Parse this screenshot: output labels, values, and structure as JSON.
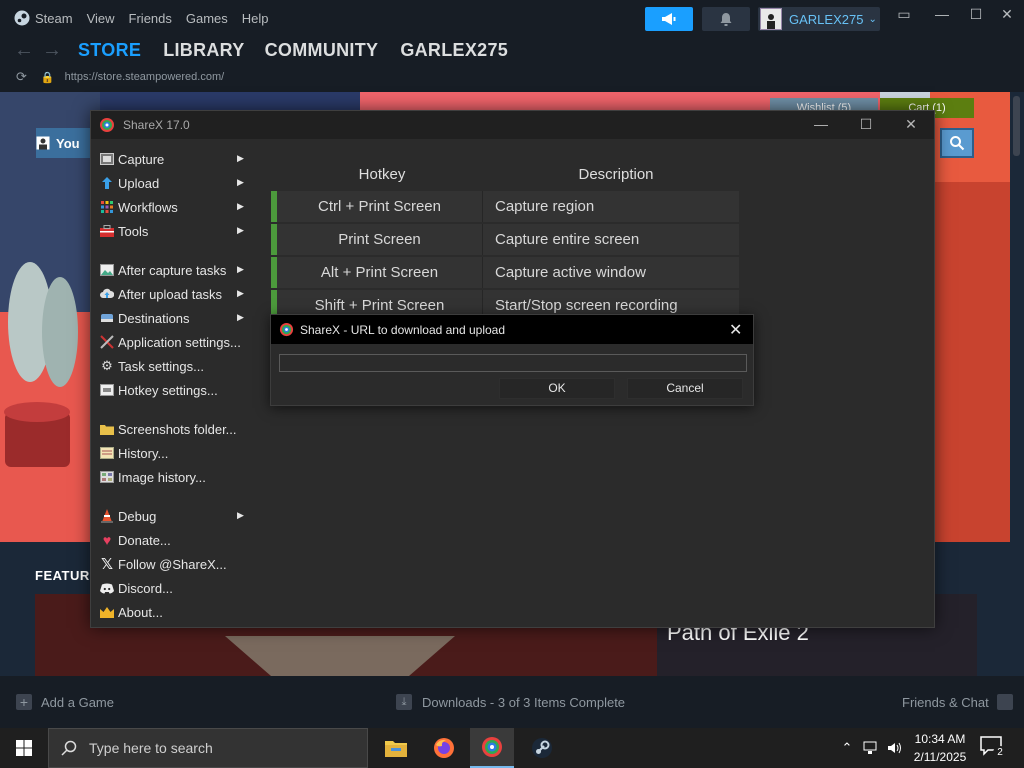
{
  "steam": {
    "menu": [
      "Steam",
      "View",
      "Friends",
      "Games",
      "Help"
    ],
    "username": "GARLEX275",
    "tabs": [
      "STORE",
      "LIBRARY",
      "COMMUNITY",
      "GARLEX275"
    ],
    "url": "https://store.steampowered.com/",
    "store": {
      "search_label": "You",
      "wishlist": "Wishlist (5)",
      "cart": "Cart (1)",
      "featured_label": "FEATUR",
      "featured_game": "Path of Exile 2"
    },
    "bottom": {
      "add_game": "Add a Game",
      "downloads": "Downloads - 3 of 3 Items Complete",
      "friends_chat": "Friends & Chat"
    },
    "colors": {
      "accent": "#1a9fff",
      "link": "#67c1f5",
      "bg": "#171d25"
    }
  },
  "sharex": {
    "title": "ShareX 17.0",
    "menu": [
      {
        "label": "Capture",
        "icon": "capture-icon",
        "submenu": true
      },
      {
        "label": "Upload",
        "icon": "upload-arrow-icon",
        "submenu": true
      },
      {
        "label": "Workflows",
        "icon": "workflows-grid-icon",
        "submenu": true
      },
      {
        "label": "Tools",
        "icon": "toolbox-icon",
        "submenu": true
      },
      {
        "label": "After capture tasks",
        "icon": "image-icon",
        "submenu": true
      },
      {
        "label": "After upload tasks",
        "icon": "cloud-upload-icon",
        "submenu": true
      },
      {
        "label": "Destinations",
        "icon": "destinations-icon",
        "submenu": true
      },
      {
        "label": "Application settings...",
        "icon": "wrench-screwdriver-icon",
        "submenu": false
      },
      {
        "label": "Task settings...",
        "icon": "gear-icon",
        "submenu": false
      },
      {
        "label": "Hotkey settings...",
        "icon": "keyboard-icon",
        "submenu": false
      },
      {
        "label": "Screenshots folder...",
        "icon": "folder-icon",
        "submenu": false
      },
      {
        "label": "History...",
        "icon": "history-icon",
        "submenu": false
      },
      {
        "label": "Image history...",
        "icon": "image-history-icon",
        "submenu": false
      },
      {
        "label": "Debug",
        "icon": "warning-cone-icon",
        "submenu": true
      },
      {
        "label": "Donate...",
        "icon": "heart-icon",
        "submenu": false
      },
      {
        "label": "Follow @ShareX...",
        "icon": "x-logo-icon",
        "submenu": false
      },
      {
        "label": "Discord...",
        "icon": "discord-icon",
        "submenu": false
      },
      {
        "label": "About...",
        "icon": "crown-icon",
        "submenu": false
      }
    ],
    "hotkeys": {
      "headers": [
        "Hotkey",
        "Description"
      ],
      "rows": [
        {
          "key": "Ctrl + Print Screen",
          "desc": "Capture region"
        },
        {
          "key": "Print Screen",
          "desc": "Capture entire screen"
        },
        {
          "key": "Alt + Print Screen",
          "desc": "Capture active window"
        },
        {
          "key": "Shift + Print Screen",
          "desc": "Start/Stop screen recording"
        }
      ]
    },
    "dialog": {
      "title": "ShareX - URL to download and upload",
      "url_value": "",
      "ok": "OK",
      "cancel": "Cancel"
    }
  },
  "taskbar": {
    "search_placeholder": "Type here to search",
    "time": "10:34 AM",
    "date": "2/11/2025",
    "notifications": "2"
  }
}
